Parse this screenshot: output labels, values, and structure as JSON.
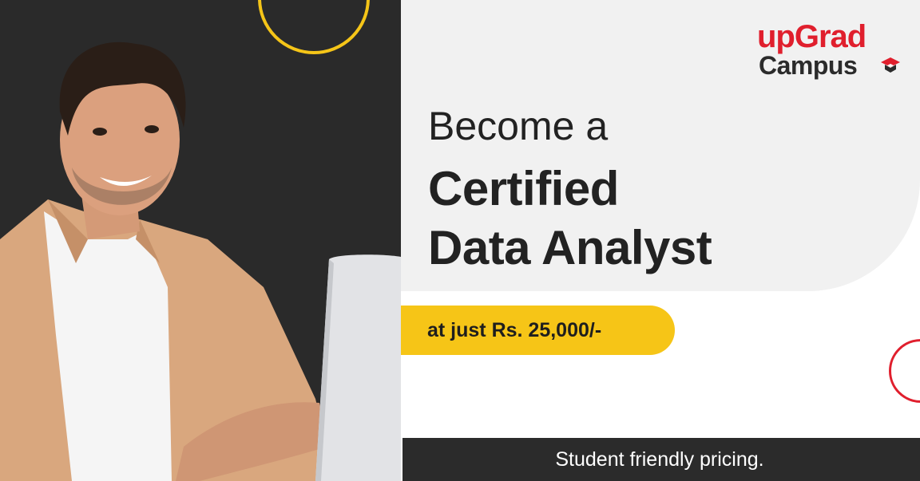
{
  "logo": {
    "line1": "upGrad",
    "line2": "Campus",
    "mark_icon": "graduation-cap-icon"
  },
  "headline": {
    "intro": "Become a",
    "line1": "Certified",
    "line2": "Data Analyst"
  },
  "price": {
    "label": "at just Rs. 25,000/-"
  },
  "footer": {
    "tagline": "Student friendly pricing."
  },
  "colors": {
    "brand_red": "#e01f2d",
    "accent_yellow": "#f6c517",
    "dark": "#2a2a2a",
    "light_grey": "#f1f1f1"
  }
}
